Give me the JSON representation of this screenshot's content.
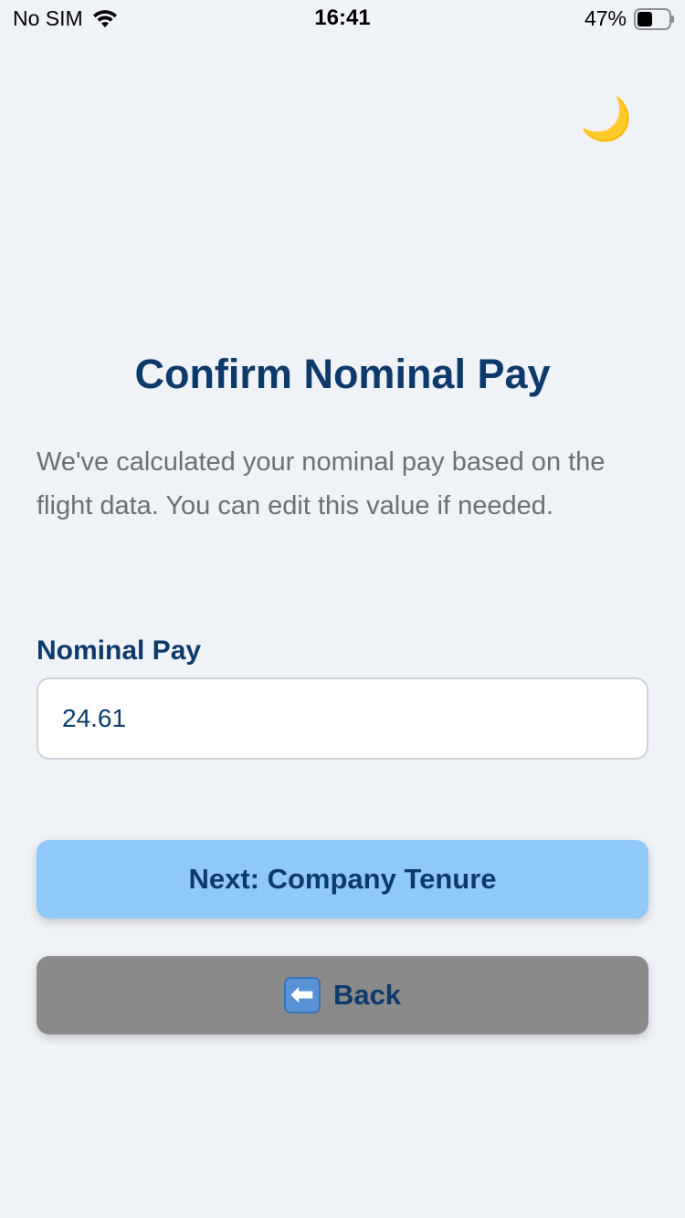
{
  "status_bar": {
    "carrier": "No SIM",
    "time": "16:41",
    "battery_percent": "47%",
    "battery_level": 0.47
  },
  "theme_toggle": {
    "icon": "crescent-moon-icon",
    "glyph": "🌙"
  },
  "page": {
    "title": "Confirm Nominal Pay",
    "description": "We've calculated your nominal pay based on the flight data. You can edit this value if needed."
  },
  "form": {
    "label": "Nominal Pay",
    "value": "24.61"
  },
  "buttons": {
    "next_label": "Next: Company Tenure",
    "back_label": "Back",
    "back_icon": "left-arrow-icon",
    "back_glyph": "⬅"
  },
  "colors": {
    "accent_text": "#0d3a6b",
    "next_button_bg": "#90c9f7",
    "back_button_bg": "#8a8a8a",
    "page_bg": "#eff2f7"
  }
}
